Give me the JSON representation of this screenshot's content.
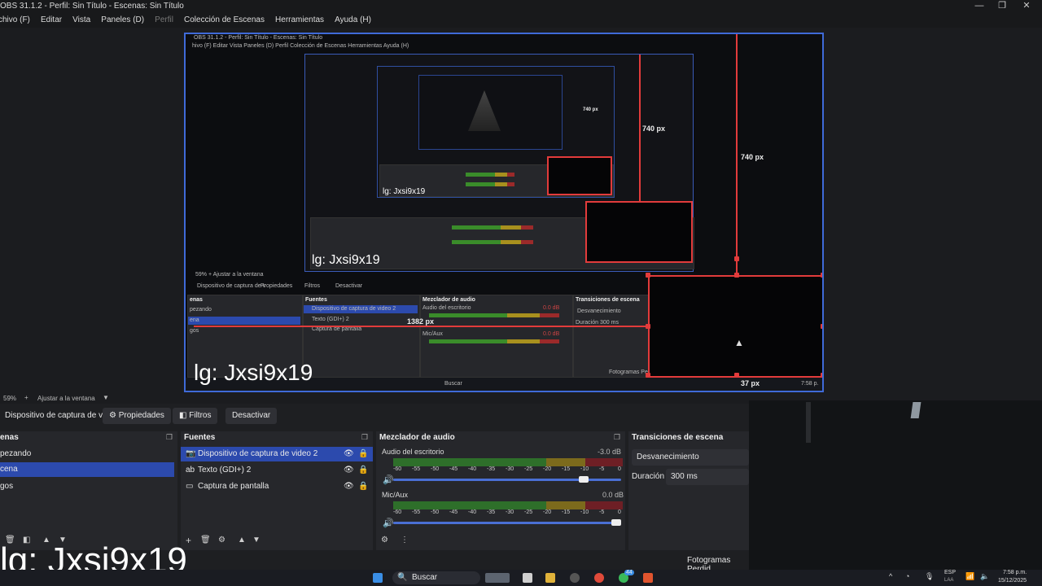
{
  "window": {
    "title": "OBS 31.1.2 - Perfil: Sin Título - Escenas: Sin Título",
    "controls": {
      "minimize": "—",
      "maximize": "❐",
      "close": "✕"
    }
  },
  "menu": {
    "items": [
      "Archivo (F)",
      "Editar",
      "Vista",
      "Paneles (D)",
      "Perfil",
      "Colección de Escenas",
      "Herramientas",
      "Ayuda (H)"
    ]
  },
  "preview": {
    "overlay_text": "lg: Jxsi9x19",
    "labels": {
      "height_outer": "740 px",
      "height_mid": "740 px",
      "height_inner": "740 px",
      "width_mid": "1382 px",
      "width_bottom": "37 px"
    },
    "nested_title": "OBS 31.1.2 - Perfil: Sin Título - Escenas: Sin Título",
    "nested_menu": "hivo (F)   Editar   Vista   Paneles (D)   Perfil   Colección de Escenas   Herramientas   Ayuda (H)",
    "nested_zoom": "59%   +   Ajustar a la ventana",
    "nested_toolbar": [
      "Dispositivo de captura de v",
      "Propiedades",
      "Filtros",
      "Desactivar"
    ],
    "nested_scenes_title": "enas",
    "nested_scenes": [
      "pezando",
      "ena",
      "gos"
    ],
    "nested_sources_title": "Fuentes",
    "nested_sources": [
      "Dispositivo de captura de video 2",
      "Texto (GDI+) 2",
      "Captura de pantalla"
    ],
    "nested_mixer_title": "Mezclador de audio",
    "nested_mixer": [
      "Audio del escritorio",
      "Mic/Aux"
    ],
    "nested_mixer_db": [
      "0.0 dB",
      "0.0 dB"
    ],
    "nested_transitions_title": "Transiciones de escena",
    "nested_transition": "Desvanecimiento",
    "nested_duration_label": "Duración",
    "nested_duration": "300 ms",
    "nested_status": "Fotogramas Perdi",
    "nested_search": "Buscar",
    "nested_clock": "7:58 p."
  },
  "zoom": {
    "level": "59%",
    "plus": "+",
    "fit_label": "Ajustar a la ventana",
    "dropdown": "▼"
  },
  "toolbar": {
    "source_name": "Dispositivo de captura de v",
    "properties": "Propiedades",
    "filters": "Filtros",
    "deactivate": "Desactivar"
  },
  "scenes": {
    "title": "enas",
    "items": [
      "pezando",
      "cena",
      "gos"
    ],
    "selected_index": 1
  },
  "sources": {
    "title": "Fuentes",
    "items": [
      {
        "label": "Dispositivo de captura de video 2",
        "icon": "camera-icon"
      },
      {
        "label": "Texto (GDI+) 2",
        "icon": "text-icon"
      },
      {
        "label": "Captura de pantalla",
        "icon": "monitor-icon"
      }
    ],
    "selected_index": 0
  },
  "mixer": {
    "title": "Mezclador de audio",
    "channels": [
      {
        "name": "Audio del escritorio",
        "db": "-3.0 dB",
        "volume": 0.85
      },
      {
        "name": "Mic/Aux",
        "db": "0.0 dB",
        "volume": 1.0
      }
    ],
    "scale": [
      "-60",
      "-55",
      "-50",
      "-45",
      "-40",
      "-35",
      "-30",
      "-25",
      "-20",
      "-15",
      "-10",
      "-5",
      "0"
    ]
  },
  "transitions": {
    "title": "Transiciones de escena",
    "selected": "Desvanecimiento",
    "duration_label": "Duración",
    "duration_value": "300 ms"
  },
  "status": {
    "dropped_frames": "Fotogramas Perdid"
  },
  "taskbar": {
    "search_placeholder": "Buscar",
    "lang": "ESP",
    "lang_sub": "LAA",
    "time": "7:58 p.m.",
    "date": "15/12/2025",
    "badge": "44"
  },
  "colors": {
    "accent": "#2c4aad",
    "selection_red": "#e23b3b",
    "preview_border": "#3f6ad8"
  }
}
